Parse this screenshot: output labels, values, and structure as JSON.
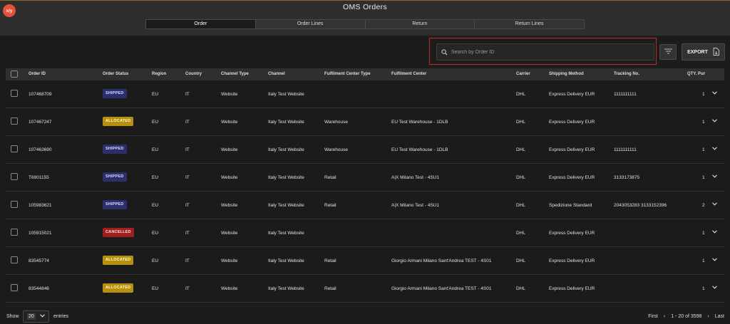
{
  "app": {
    "logo": "x/y",
    "title": "OMS Orders"
  },
  "tabs": [
    {
      "label": "Order",
      "active": true
    },
    {
      "label": "Order Lines",
      "active": false
    },
    {
      "label": "Return",
      "active": false
    },
    {
      "label": "Return Lines",
      "active": false
    }
  ],
  "toolbar": {
    "search_placeholder": "Search by Order ID",
    "search_icon": "search-icon",
    "filter_icon": "filter-icon",
    "export_label": "EXPORT",
    "export_icon": "file-export-icon"
  },
  "colors": {
    "shipped": "#2b2f6e",
    "allocated": "#b7910e",
    "cancelled": "#9e1f1f",
    "highlight": "#c0282a"
  },
  "table": {
    "headers": [
      "Order ID",
      "Order Status",
      "Region",
      "Country",
      "Channel Type",
      "Channel",
      "Fulfilment Center Type",
      "Fulfilment Center",
      "Carrier",
      "Shipping Method",
      "Tracking No.",
      "QTY. Pur"
    ],
    "rows": [
      {
        "order_id": "107468709",
        "status": "SHIPPED",
        "region": "EU",
        "country": "IT",
        "channel_type": "Website",
        "channel": "Italy Test Website",
        "fc_type": "",
        "fc": "",
        "carrier": "DHL",
        "shipping": "Express Delivery EUR",
        "tracking": "1111111111",
        "qty": "1"
      },
      {
        "order_id": "107467247",
        "status": "ALLOCATED",
        "region": "EU",
        "country": "IT",
        "channel_type": "Website",
        "channel": "Italy Test Website",
        "fc_type": "Warehouse",
        "fc": "EU Test Warehouse - 1DLB",
        "carrier": "DHL",
        "shipping": "Express Delivery EUR",
        "tracking": "",
        "qty": "1"
      },
      {
        "order_id": "107463690",
        "status": "SHIPPED",
        "region": "EU",
        "country": "IT",
        "channel_type": "Website",
        "channel": "Italy Test Website",
        "fc_type": "Warehouse",
        "fc": "EU Test Warehouse - 1DLB",
        "carrier": "DHL",
        "shipping": "Express Delivery EUR",
        "tracking": "1111111111",
        "qty": "1"
      },
      {
        "order_id": "T6901155",
        "status": "SHIPPED",
        "region": "EU",
        "country": "IT",
        "channel_type": "Website",
        "channel": "Italy Test Website",
        "fc_type": "Retail",
        "fc": "A|X Milano Test - 4SU1",
        "carrier": "DHL",
        "shipping": "Express Delivery EUR",
        "tracking": "3133173875",
        "qty": "1"
      },
      {
        "order_id": "105983621",
        "status": "SHIPPED",
        "region": "EU",
        "country": "IT",
        "channel_type": "Website",
        "channel": "Italy Test Website",
        "fc_type": "Retail",
        "fc": "A|X Milano Test - 4SU1",
        "carrier": "DHL",
        "shipping": "Spedizione Standard",
        "tracking": "2043053283 3133152396",
        "qty": "2"
      },
      {
        "order_id": "105915021",
        "status": "CANCELLED",
        "region": "EU",
        "country": "IT",
        "channel_type": "Website",
        "channel": "Italy Test Website",
        "fc_type": "",
        "fc": "",
        "carrier": "DHL",
        "shipping": "Express Delivery EUR",
        "tracking": "",
        "qty": "1"
      },
      {
        "order_id": "83545774",
        "status": "ALLOCATED",
        "region": "EU",
        "country": "IT",
        "channel_type": "Website",
        "channel": "Italy Test Website",
        "fc_type": "Retail",
        "fc": "Giorgio Armani Milano Sant'Andrea TEST - 4S01",
        "carrier": "DHL",
        "shipping": "Express Delivery EUR",
        "tracking": "",
        "qty": "1"
      },
      {
        "order_id": "83544846",
        "status": "ALLOCATED",
        "region": "EU",
        "country": "IT",
        "channel_type": "Website",
        "channel": "Italy Test Website",
        "fc_type": "Retail",
        "fc": "Giorgio Armani Milano Sant'Andrea TEST - 4S01",
        "carrier": "DHL",
        "shipping": "Express Delivery EUR",
        "tracking": "",
        "qty": "1"
      }
    ]
  },
  "footer": {
    "show_label": "Show",
    "page_size": "20",
    "entries_label": "entries",
    "first": "First",
    "prev": "‹",
    "range": "1 - 20 of 3598",
    "next": "›",
    "last": "Last"
  }
}
